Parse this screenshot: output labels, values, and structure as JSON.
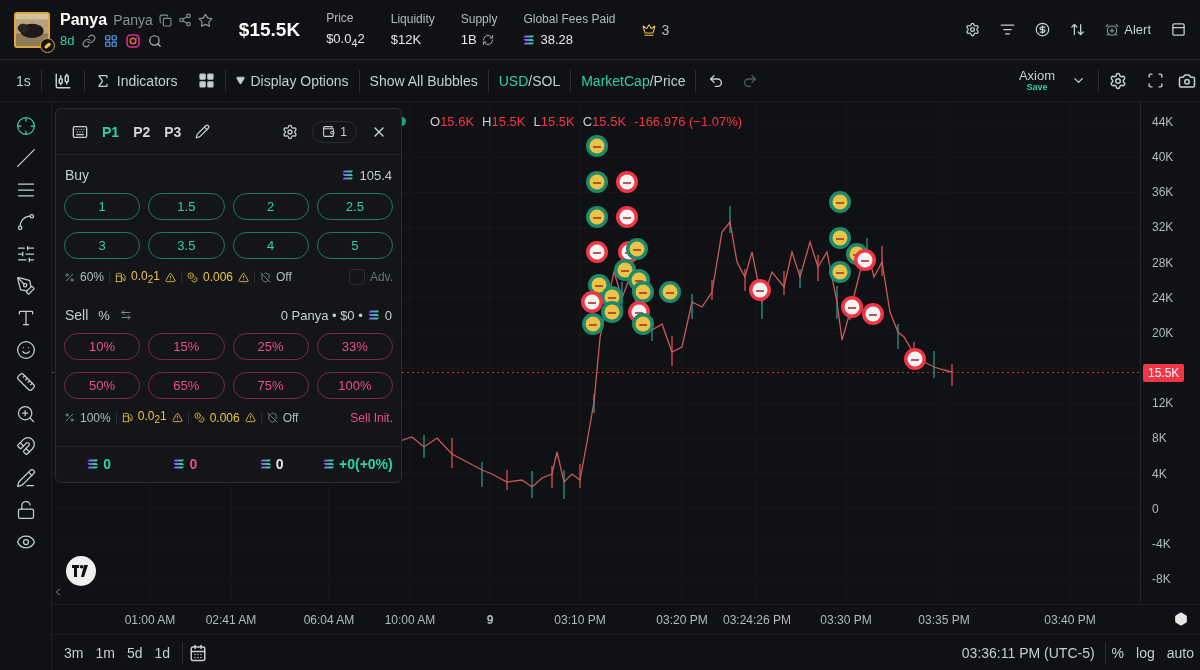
{
  "token": {
    "name": "Panya",
    "ticker": "Panya",
    "age": "8d"
  },
  "market_cap": "$15.5K",
  "stats": [
    {
      "label": "Price",
      "value": "$0.0$_{4}$2",
      "kind": "plain"
    },
    {
      "label": "Liquidity",
      "value": "$12K",
      "kind": "plain"
    },
    {
      "label": "Supply",
      "value": "1B",
      "kind": "refresh"
    },
    {
      "label": "Global Fees Paid",
      "value": "38.28",
      "kind": "sol"
    }
  ],
  "crown_count": "3",
  "alert_label": "Alert",
  "toolbar": {
    "interval": "1s",
    "indicators": "Indicators",
    "display_options": "Display Options",
    "bubbles": "Show All Bubbles",
    "currency": {
      "separator": "/",
      "options": [
        {
          "label": "USD",
          "selected": true
        },
        {
          "label": "SOL",
          "selected": false
        }
      ]
    },
    "mode": {
      "separator": "/",
      "options": [
        {
          "label": "MarketCap",
          "selected": true
        },
        {
          "label": "Price",
          "selected": false
        }
      ]
    },
    "layout_name": "Axiom",
    "layout_status": "Save"
  },
  "drawing_tools": [
    {
      "selected": true
    },
    {
      "selected": false
    },
    {
      "selected": false
    },
    {
      "selected": false
    },
    {
      "selected": false
    },
    {
      "selected": false
    },
    {
      "selected": false
    },
    {
      "selected": false
    },
    {
      "selected": false
    },
    {
      "selected": false
    },
    {
      "selected": false
    },
    {
      "selected": false
    },
    {
      "selected": false
    },
    {
      "selected": false
    }
  ],
  "legend": {
    "items": [
      {
        "label": "O",
        "value": "15.6K"
      },
      {
        "label": "H",
        "value": "15.5K"
      },
      {
        "label": "L",
        "value": "15.5K"
      },
      {
        "label": "C",
        "value": "15.5K"
      }
    ],
    "change": "-166.976 (−1.07%)"
  },
  "trade_panel": {
    "presets": [
      {
        "label": "P1",
        "selected": true
      },
      {
        "label": "P2",
        "selected": false
      },
      {
        "label": "P3",
        "selected": false
      }
    ],
    "wallet_count": "1",
    "buy": {
      "title": "Buy",
      "balance": "105.4",
      "amounts": [
        "1",
        "1.5",
        "2",
        "2.5",
        "3",
        "3.5",
        "4",
        "5"
      ],
      "settings": {
        "slippage": "60%",
        "priority": "0.0$_{2}$1",
        "bribe": "0.006",
        "mev": "Off"
      },
      "advanced": {
        "label": "Adv.",
        "checked": false
      }
    },
    "sell": {
      "title": "Sell",
      "unit": "%",
      "holdings": "0 Panya • $0 •",
      "holdings_sol": "0",
      "amounts": [
        "10%",
        "15%",
        "25%",
        "33%",
        "50%",
        "65%",
        "75%",
        "100%"
      ],
      "settings": {
        "slippage": "100%",
        "priority": "0.0$_{2}$1",
        "bribe": "0.006",
        "mev": "Off"
      },
      "init_label": "Sell Init."
    },
    "totals": [
      {
        "value": "0",
        "color": "#2fd39b"
      },
      {
        "value": "0",
        "color": "#ec4f82"
      },
      {
        "value": "0",
        "color": "#e6e6e6"
      },
      {
        "value": "+0(+0%)",
        "color": "#2fd39b"
      }
    ]
  },
  "y_axis": {
    "ticks": [
      "44K",
      "40K",
      "36K",
      "32K",
      "28K",
      "24K",
      "20K",
      "12K",
      "8K",
      "4K",
      "0",
      "-4K",
      "-8K"
    ],
    "current": "15.5K"
  },
  "x_axis": {
    "labels": [
      "01:00 AM",
      "02:41 AM",
      "06:04 AM",
      "10:00 AM",
      "9",
      "03:10 PM",
      "03:20 PM",
      "03:24:26 PM",
      "03:30 PM",
      "03:35 PM",
      "03:40 PM"
    ]
  },
  "bottom_bar": {
    "ranges": [
      "3m",
      "1m",
      "5d",
      "1d"
    ],
    "time": "03:36:11 PM (UTC-5)",
    "scales": [
      "%",
      "log",
      "auto"
    ]
  }
}
